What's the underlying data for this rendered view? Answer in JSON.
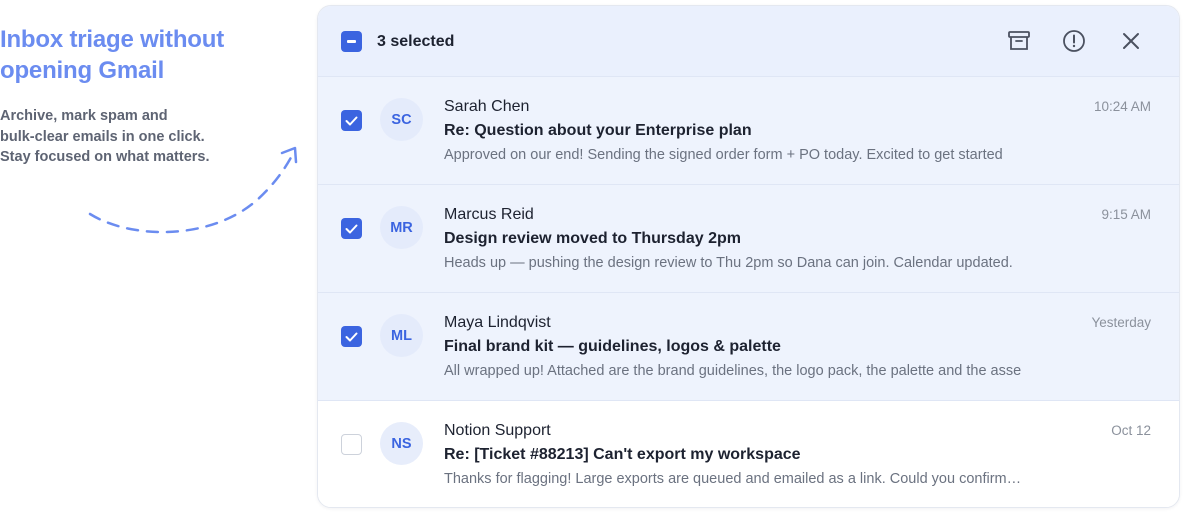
{
  "promo": {
    "title_line1": "Inbox triage without",
    "title_line2": "opening Gmail",
    "sub_line1": "Archive, mark spam and",
    "sub_line2": "bulk-clear emails in one click.",
    "sub_line3": "Stay focused on what matters."
  },
  "header": {
    "selected_label": "3 selected",
    "actions": [
      {
        "icon": "archive-icon"
      },
      {
        "icon": "spam-alert-icon"
      },
      {
        "icon": "close-icon"
      }
    ]
  },
  "colors": {
    "accent": "#3b64e0",
    "promo_title": "#6b8cf0",
    "selected_row_bg": "#eef3fd",
    "header_bg": "#eaf0fd"
  },
  "emails": [
    {
      "selected": true,
      "initials": "SC",
      "sender": "Sarah Chen",
      "subject": "Re: Question about your Enterprise plan",
      "preview": "Approved on our end! Sending the signed order form + PO today. Excited to get started",
      "time": "10:24 AM"
    },
    {
      "selected": true,
      "initials": "MR",
      "sender": "Marcus Reid",
      "subject": "Design review moved to Thursday 2pm",
      "preview": "Heads up — pushing the design review to Thu 2pm so Dana can join. Calendar updated.",
      "time": "9:15 AM"
    },
    {
      "selected": true,
      "initials": "ML",
      "sender": "Maya Lindqvist",
      "subject": "Final brand kit — guidelines, logos & palette",
      "preview": "All wrapped up! Attached are the brand guidelines, the logo pack, the palette and the asse",
      "time": "Yesterday"
    },
    {
      "selected": false,
      "initials": "NS",
      "sender": "Notion Support",
      "subject": "Re: [Ticket #88213] Can't export my workspace",
      "preview": "Thanks for flagging! Large exports are queued and emailed as a link. Could you confirm…",
      "time": "Oct 12"
    }
  ]
}
